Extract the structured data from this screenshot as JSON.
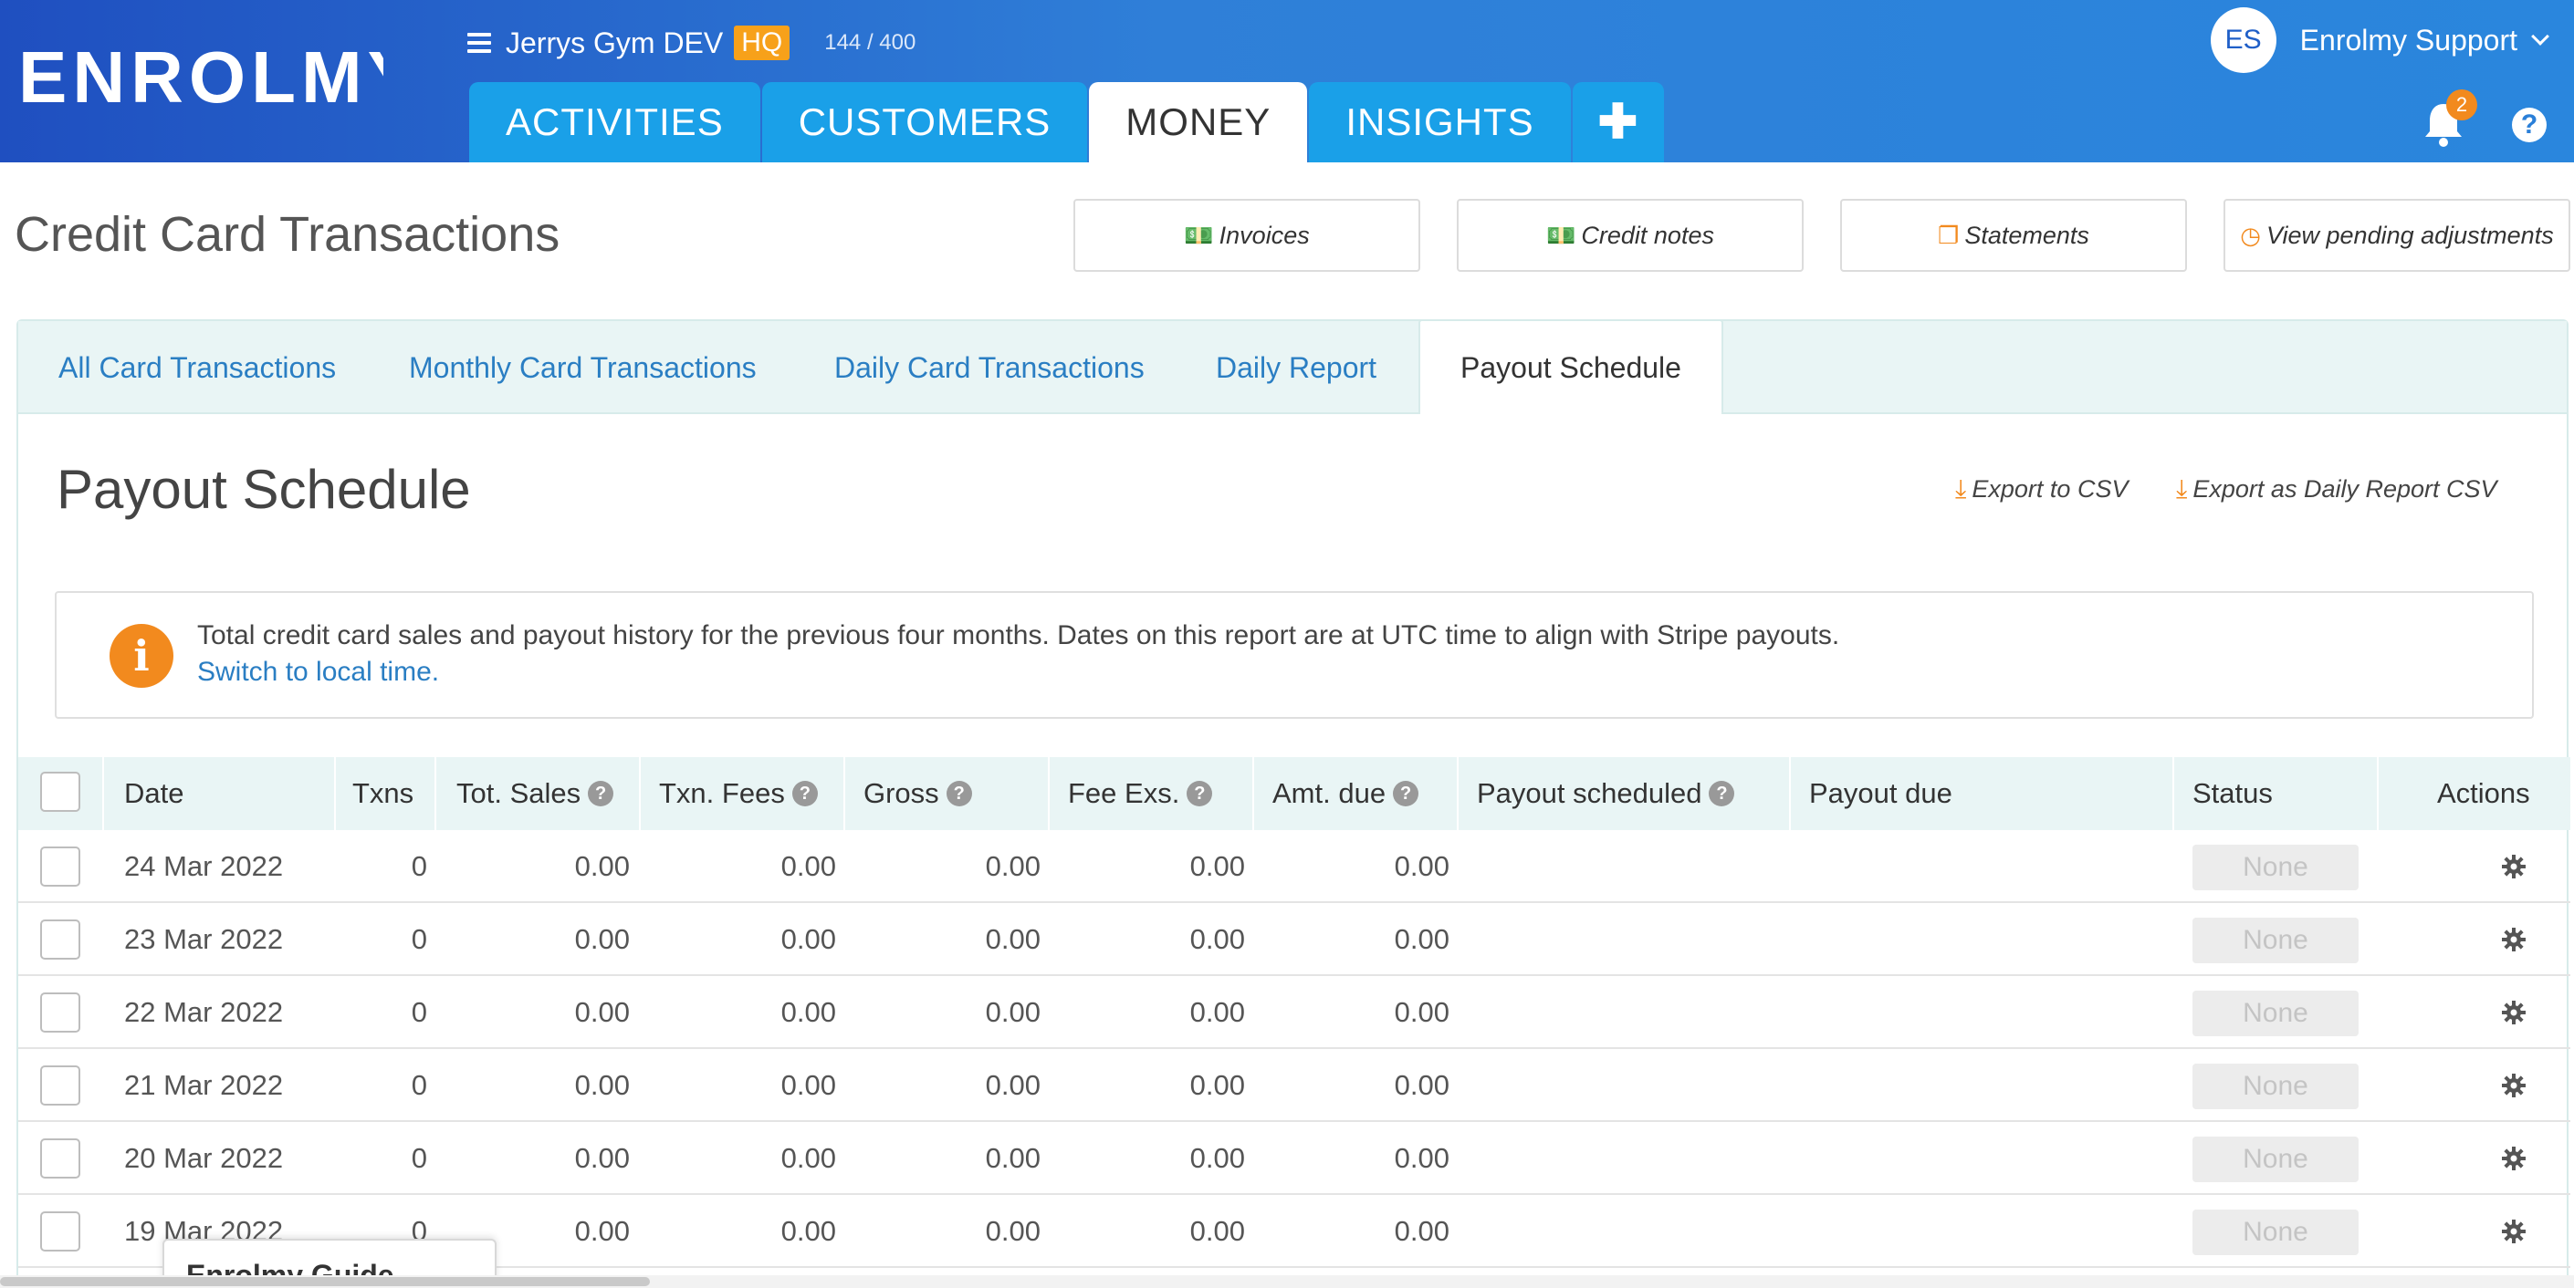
{
  "app": {
    "brand": "ENROLMY",
    "org_name": "Jerrys Gym DEV",
    "org_badge": "HQ",
    "usage": "144 / 400",
    "user_initials": "ES",
    "user_name": "Enrolmy Support",
    "notifications": "2",
    "help": "?"
  },
  "nav": {
    "tabs": [
      {
        "label": "ACTIVITIES"
      },
      {
        "label": "CUSTOMERS"
      },
      {
        "label": "MONEY",
        "active": true
      },
      {
        "label": "INSIGHTS"
      }
    ],
    "plus": "✚"
  },
  "page": {
    "title": "Credit Card Transactions",
    "buttons": [
      {
        "label": "Invoices",
        "icon": "money-icon"
      },
      {
        "label": "Credit notes",
        "icon": "money-icon"
      },
      {
        "label": "Statements",
        "icon": "copy-icon"
      },
      {
        "label": "View pending adjustments",
        "icon": "clock-icon"
      }
    ]
  },
  "subtabs": [
    {
      "label": "All Card Transactions"
    },
    {
      "label": "Monthly Card Transactions"
    },
    {
      "label": "Daily Card Transactions"
    },
    {
      "label": "Daily Report"
    },
    {
      "label": "Payout Schedule",
      "active": true
    }
  ],
  "section": {
    "title": "Payout Schedule",
    "export_csv": "Export to CSV",
    "export_daily": "Export as Daily Report CSV"
  },
  "info": {
    "text": "Total credit card sales and payout history for the previous four months. Dates on this report are at UTC time to align with Stripe payouts.",
    "link": "Switch to local time."
  },
  "table": {
    "columns": {
      "date": "Date",
      "txns": "Txns",
      "tot_sales": "Tot. Sales",
      "txn_fees": "Txn. Fees",
      "gross": "Gross",
      "fee_exs": "Fee Exs.",
      "amt_due": "Amt. due",
      "payout_scheduled": "Payout scheduled",
      "payout_due": "Payout due",
      "status": "Status",
      "actions": "Actions"
    },
    "rows": [
      {
        "date": "24 Mar 2022",
        "txns": "0",
        "tot_sales": "0.00",
        "txn_fees": "0.00",
        "gross": "0.00",
        "fee_exs": "0.00",
        "amt_due": "0.00",
        "status": "None"
      },
      {
        "date": "23 Mar 2022",
        "txns": "0",
        "tot_sales": "0.00",
        "txn_fees": "0.00",
        "gross": "0.00",
        "fee_exs": "0.00",
        "amt_due": "0.00",
        "status": "None"
      },
      {
        "date": "22 Mar 2022",
        "txns": "0",
        "tot_sales": "0.00",
        "txn_fees": "0.00",
        "gross": "0.00",
        "fee_exs": "0.00",
        "amt_due": "0.00",
        "status": "None"
      },
      {
        "date": "21 Mar 2022",
        "txns": "0",
        "tot_sales": "0.00",
        "txn_fees": "0.00",
        "gross": "0.00",
        "fee_exs": "0.00",
        "amt_due": "0.00",
        "status": "None"
      },
      {
        "date": "20 Mar 2022",
        "txns": "0",
        "tot_sales": "0.00",
        "txn_fees": "0.00",
        "gross": "0.00",
        "fee_exs": "0.00",
        "amt_due": "0.00",
        "status": "None"
      },
      {
        "date": "19 Mar 2022",
        "txns": "0",
        "tot_sales": "0.00",
        "txn_fees": "0.00",
        "gross": "0.00",
        "fee_exs": "0.00",
        "amt_due": "0.00",
        "status": "None"
      }
    ]
  },
  "guide": {
    "label": "Enrolmy Guide"
  },
  "colors": {
    "accent": "#f28a1e",
    "link": "#2a7ec3",
    "header_start": "#1f4fc0",
    "header_end": "#2a86dd"
  }
}
